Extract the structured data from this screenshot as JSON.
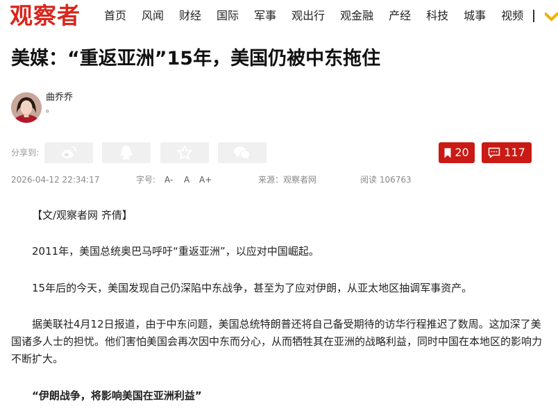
{
  "site": {
    "logo": "观察者"
  },
  "nav": {
    "items": [
      "首页",
      "风闻",
      "财经",
      "国际",
      "军事",
      "观出行",
      "观金融",
      "产经",
      "科技",
      "城事",
      "视频"
    ]
  },
  "article": {
    "title": "美媒：“重返亚洲”15年，美国仍被中东拖住",
    "author": {
      "name": "曲乔乔",
      "subtitle": "。"
    },
    "share": {
      "label": "分享到:",
      "icons": [
        "weibo-icon",
        "qq-icon",
        "qzone-icon",
        "wechat-icon"
      ]
    },
    "favorites_count": "20",
    "comments_count": "117",
    "meta": {
      "datetime": "2026-04-12 22:34:17",
      "font_size_label": "字号:",
      "font_small": "A-",
      "font_normal": "A",
      "font_large": "A+",
      "source": "来源：观察者网",
      "reads": "阅读 106763"
    },
    "paragraphs": [
      "【文/观察者网 齐倩】",
      "2011年，美国总统奥巴马呼吁“重返亚洲”，以应对中国崛起。",
      "15年后的今天，美国发现自己仍深陷中东战争，甚至为了应对伊朗，从亚太地区抽调军事资产。",
      "据美联社4月12日报道，由于中东问题，美国总统特朗普还将自己备受期待的访华行程推迟了数周。这加深了美国诸多人士的担忧。他们害怕美国会再次因中东而分心，从而牺牲其在亚洲的战略利益，同时中国在本地区的影响力不断扩大。",
      "“伊朗战争，将影响美国在亚洲利益”"
    ]
  },
  "colors": {
    "brand": "#d9261c",
    "button": "#c91a15",
    "share_bg": "#f0f0f0"
  }
}
